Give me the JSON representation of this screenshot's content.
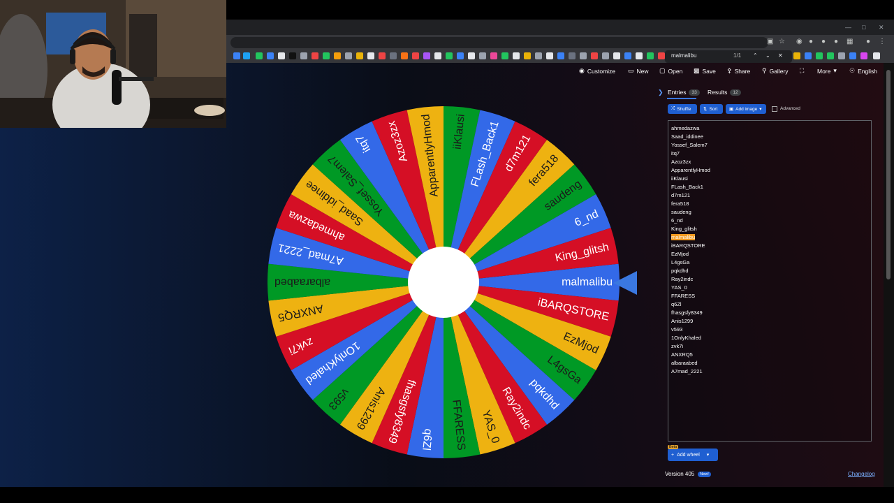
{
  "find_bar": {
    "query": "malmalibu",
    "count": "1/1"
  },
  "toolbar": {
    "customize": "Customize",
    "new": "New",
    "open": "Open",
    "save": "Save",
    "share": "Share",
    "gallery": "Gallery",
    "more": "More",
    "language": "English"
  },
  "panel": {
    "entries_label": "Entries",
    "entries_count": "33",
    "results_label": "Results",
    "results_count": "12",
    "shuffle": "Shuffle",
    "sort": "Sort",
    "add_image": "Add image",
    "advanced": "Advanced",
    "add_wheel": "Add wheel",
    "beta": "Beta",
    "version": "Version 405",
    "new_badge": "New!",
    "changelog": "Changelog"
  },
  "entries": [
    "ahmedazwa",
    "Saad_iddinee",
    "Yossef_Salem7",
    "itq7",
    "Azoz3zx",
    "ApparentlyHmod",
    "iiKlausi",
    "FLash_Back1",
    "d7m121",
    "fera518",
    "saudeng",
    "6_nd",
    "King_glitsh",
    "malmalibu",
    "iBARQSTORE",
    "EzMjod",
    "L4gsGa",
    "pqkdhd",
    "Ray2indc",
    "YAS_0",
    "FFARESS",
    "q6Zl",
    "fhasgsfy8349",
    "Anis1299",
    "v593",
    "1OnlyKhaled",
    "zvk7i",
    "ANXRQ5",
    "albaraabed",
    "A7mad_2221"
  ],
  "highlighted_entry": "malmalibu",
  "wheel": {
    "segments": [
      "malmalibu",
      "iBARQSTORE",
      "EzMjod",
      "L4gsGa",
      "pqkdhd",
      "Ray2indc",
      "YAS_0",
      "FFARESS",
      "q6Zl",
      "fhasgsfy8349",
      "Anis1299",
      "v593",
      "1OnlyKhaled",
      "zvk7i",
      "ANXRQ5",
      "albaraabed",
      "A7mad_2221",
      "ahmedazwa",
      "Saad_iddinee",
      "Yossef_Salem7",
      "itq7",
      "Azoz3zx",
      "ApparentlyHmod",
      "iiKlausi",
      "FLash_Back1",
      "d7m121",
      "fera518",
      "saudeng",
      "6_nd",
      "King_glitsh"
    ],
    "colors": [
      "#3369e8",
      "#d50f25",
      "#eeb211",
      "#009925"
    ]
  }
}
